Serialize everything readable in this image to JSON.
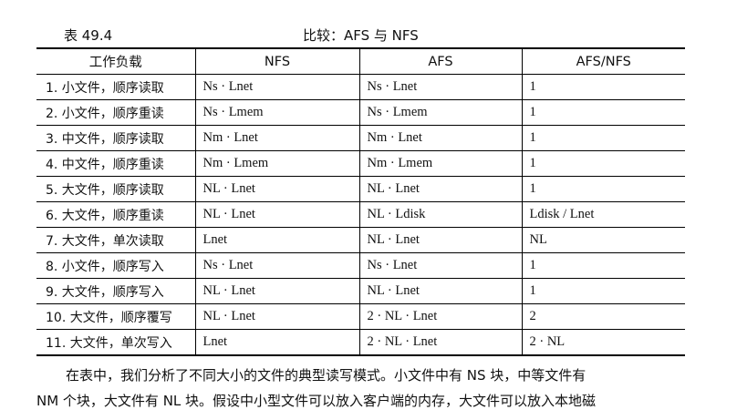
{
  "caption": {
    "number": "表 49.4",
    "title": "比较：AFS 与 NFS"
  },
  "table": {
    "headers": [
      "工作负载",
      "NFS",
      "AFS",
      "AFS/NFS"
    ],
    "rows": [
      [
        "1. 小文件，顺序读取",
        "Ns · Lnet",
        "Ns · Lnet",
        "1"
      ],
      [
        "2. 小文件，顺序重读",
        "Ns · Lmem",
        "Ns · Lmem",
        "1"
      ],
      [
        "3. 中文件，顺序读取",
        "Nm · Lnet",
        "Nm · Lnet",
        "1"
      ],
      [
        "4. 中文件，顺序重读",
        "Nm · Lmem",
        "Nm · Lmem",
        "1"
      ],
      [
        "5. 大文件，顺序读取",
        "NL · Lnet",
        "NL · Lnet",
        "1"
      ],
      [
        "6. 大文件，顺序重读",
        "NL · Lnet",
        "NL · Ldisk",
        "Ldisk / Lnet"
      ],
      [
        "7. 大文件，单次读取",
        "Lnet",
        "NL · Lnet",
        "NL"
      ],
      [
        "8. 小文件，顺序写入",
        "Ns · Lnet",
        "Ns · Lnet",
        "1"
      ],
      [
        "9. 大文件，顺序写入",
        "NL · Lnet",
        "NL · Lnet",
        "1"
      ],
      [
        "10. 大文件，顺序覆写",
        "NL · Lnet",
        "2 · NL · Lnet",
        "2"
      ],
      [
        "11. 大文件，单次写入",
        "Lnet",
        "2 · NL · Lnet",
        "2 · NL"
      ]
    ]
  },
  "paragraph": {
    "line1": "在表中，我们分析了不同大小的文件的典型读写模式。小文件中有 NS 块，中等文件有",
    "line2": "NM 个块，大文件有 NL 块。假设中小型文件可以放入客户端的内存，大文件可以放入本地磁"
  }
}
